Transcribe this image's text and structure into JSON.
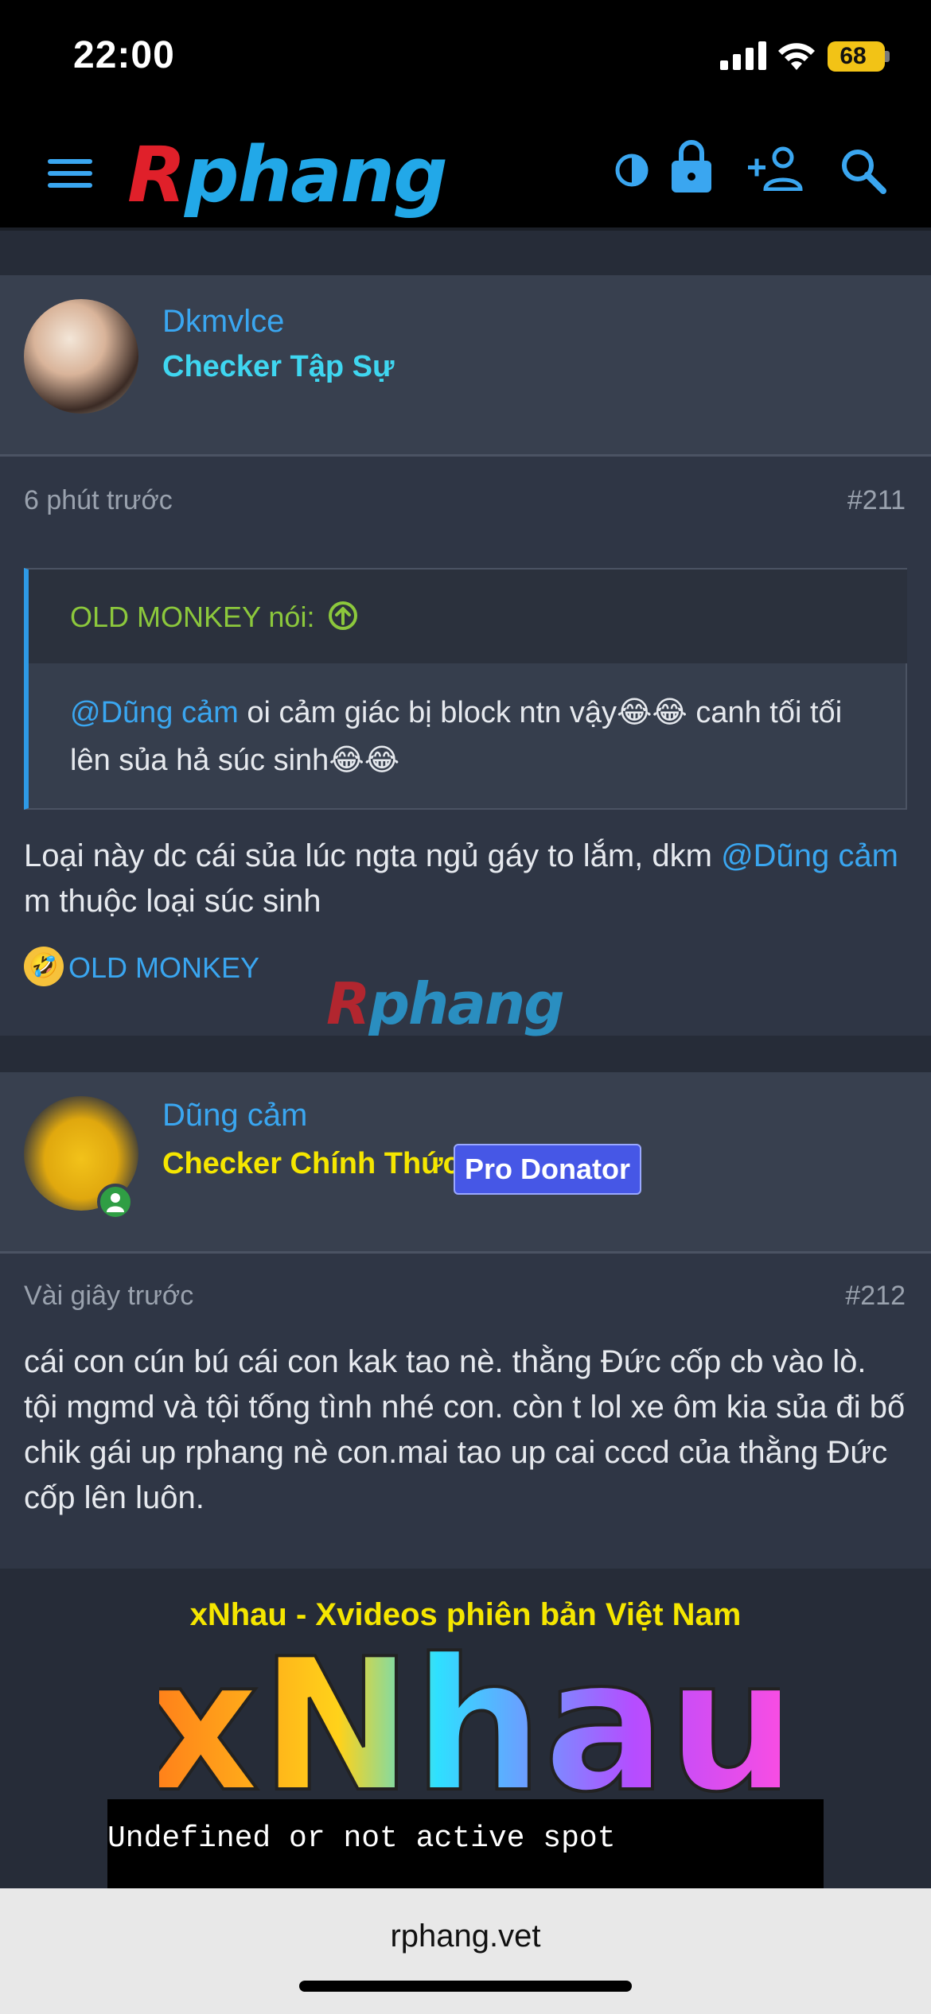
{
  "status": {
    "time": "22:00",
    "battery": "68"
  },
  "nav": {
    "logo_first": "R",
    "logo_rest": "phang"
  },
  "posts": [
    {
      "username": "Dkmvlce",
      "user_title": "Checker Tập Sự",
      "time": "6 phút trước",
      "number": "#211",
      "quote": {
        "attribution": "OLD MONKEY nói:",
        "mention": "@Dũng cảm",
        "text_part1": " oi cảm giác bị block ntn vậy😂😂 canh tối tối lên sủa hả súc sinh😂😂"
      },
      "body_part1": "Loại này dc cái sủa lúc ngta ngủ gáy to lắm, dkm ",
      "body_mention": "@Dũng cảm",
      "body_part2": " m thuộc loại súc sinh",
      "reaction": {
        "emoji": "🤣",
        "name": "OLD MONKEY"
      }
    },
    {
      "username": "Dũng cảm",
      "user_title": "Checker Chính Thức",
      "badge": "Pro Donator",
      "time": "Vài giây trước",
      "number": "#212",
      "body": "cái con cún bú cái con kak tao nè. thằng Đức cốp cb vào lò. tội mgmd và tội tống tình nhé con. còn t lol xe ôm kia sủa đi bố chik gái up rphang nè con.mai tao up cai cccd của thằng Đức cốp lên luôn."
    }
  ],
  "watermark": {
    "first": "R",
    "rest": "phang"
  },
  "ad": {
    "title": "xNhau - Xvideos phiên bản Việt Nam",
    "logo": "xNhau",
    "spot_text": "Undefined or not active spot"
  },
  "browser": {
    "url": "rphang.vet"
  },
  "colors": {
    "accent": "#3aa6f0",
    "title_cyan": "#3fd6f0",
    "title_yellow": "#f5e600",
    "quote_green": "#8cc83c",
    "badge": "#4657e6"
  }
}
